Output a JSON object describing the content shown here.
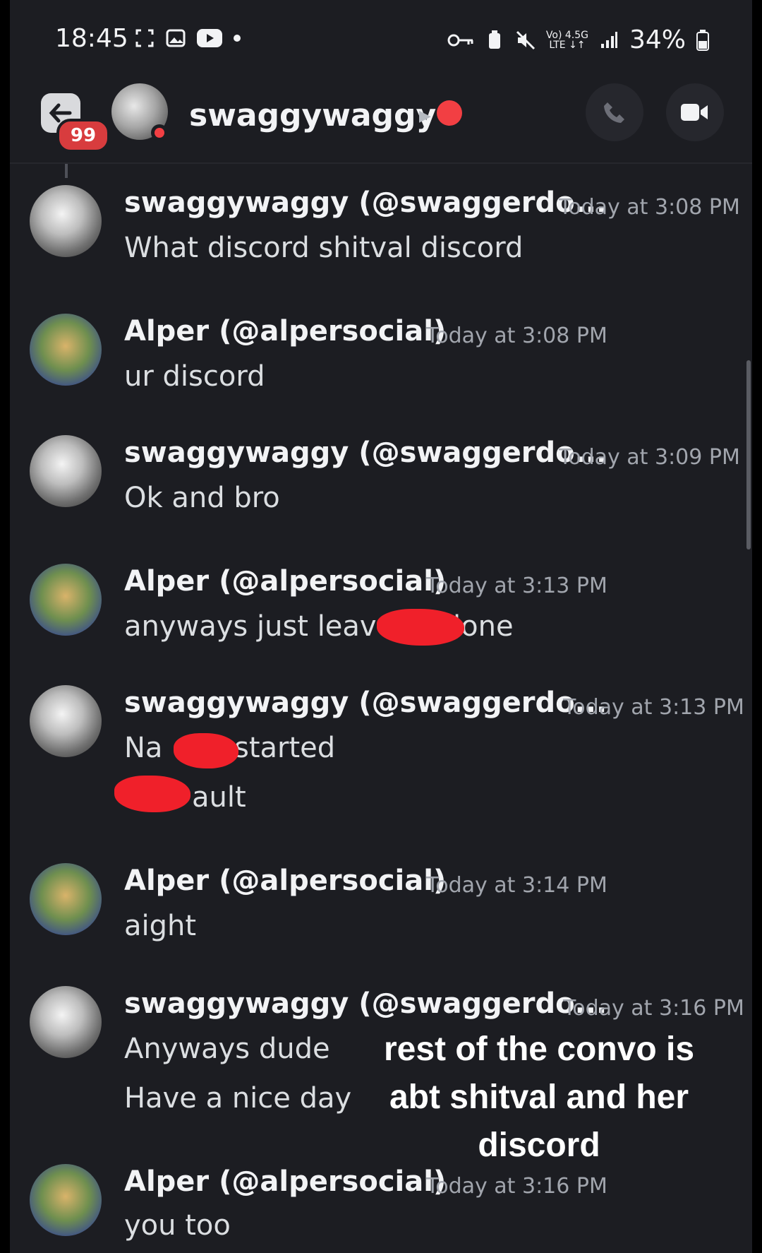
{
  "status_bar": {
    "time": "18:45",
    "network_top": "Vo) 4.5G",
    "network_bottom": "LTE ↓↑",
    "battery": "34%"
  },
  "header": {
    "back_badge": "99",
    "channel_name": "swaggywaggy",
    "icons": [
      "back-icon",
      "avatar",
      "globe-icon",
      "call-icon",
      "video-icon"
    ]
  },
  "messages": [
    {
      "author": "swaggywaggy (@swaggerdo...",
      "time": "Today at 3:08 PM",
      "lines": [
        "What discord shitval discord"
      ]
    },
    {
      "author": "Alper (@alpersocial)",
      "time": "Today at 3:08 PM",
      "lines": [
        "ur discord"
      ]
    },
    {
      "author": "swaggywaggy (@swaggerdo...",
      "time": "Today at 3:09 PM",
      "lines": [
        "Ok and bro"
      ]
    },
    {
      "author": "Alper (@alpersocial)",
      "time": "Today at 3:13 PM",
      "lines": [
        "anyways just leave",
        "lone"
      ]
    },
    {
      "author": "swaggywaggy (@swaggerdo...",
      "time": "Today at 3:13 PM",
      "lines": [
        "Na",
        "started",
        "ault"
      ]
    },
    {
      "author": "Alper (@alpersocial)",
      "time": "Today at 3:14 PM",
      "lines": [
        "aight"
      ]
    },
    {
      "author": "swaggywaggy (@swaggerdo...",
      "time": "Today at 3:16 PM",
      "lines": [
        "Anyways dude",
        "Have a nice day"
      ]
    },
    {
      "author": "Alper (@alpersocial)",
      "time": "Today at 3:16 PM",
      "lines": [
        "you too"
      ]
    }
  ],
  "overlay_caption": "rest of the convo is abt shitval and her discord"
}
